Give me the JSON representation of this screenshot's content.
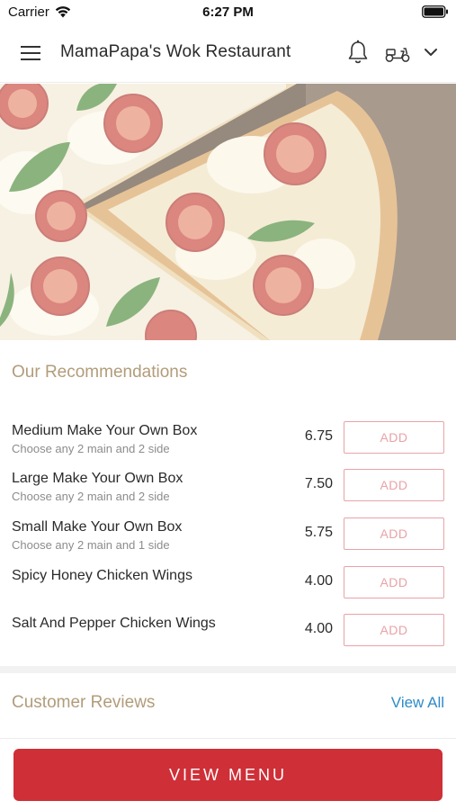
{
  "status_bar": {
    "carrier": "Carrier",
    "time": "6:27 PM"
  },
  "nav": {
    "title": "MamaPapa's Wok Restaurant",
    "icons": [
      "menu-icon",
      "bell-icon",
      "scooter-icon",
      "chevron-down-icon"
    ]
  },
  "hero": {
    "image": "pizza-photo"
  },
  "recommendations": {
    "title": "Our Recommendations",
    "add_label": "ADD",
    "items": [
      {
        "name": "Medium Make Your Own Box",
        "description": "Choose any 2 main and 2 side",
        "price": "6.75"
      },
      {
        "name": "Large Make Your Own Box",
        "description": "Choose any 2 main and 2 side",
        "price": "7.50"
      },
      {
        "name": "Small Make Your Own Box",
        "description": "Choose any 2 main and 1 side",
        "price": "5.75"
      },
      {
        "name": "Spicy Honey Chicken Wings",
        "description": "",
        "price": "4.00"
      },
      {
        "name": "Salt And Pepper Chicken Wings",
        "description": "",
        "price": "4.00"
      }
    ]
  },
  "reviews": {
    "title": "Customer Reviews",
    "view_all_label": "View All"
  },
  "bottom": {
    "view_menu_label": "VIEW MENU"
  },
  "colors": {
    "accent_red": "#cf2f37",
    "section_title": "#b29c7a",
    "link_blue": "#2e8bc8",
    "add_button": "#e8a3a8"
  }
}
